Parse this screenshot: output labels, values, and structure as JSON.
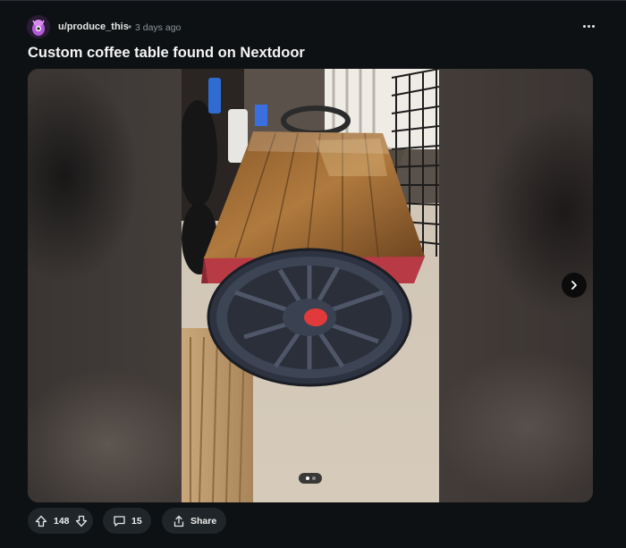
{
  "post": {
    "username": "u/produce_this",
    "separator": "•",
    "timestamp": "3 days ago",
    "title": "Custom coffee table found on Nextdoor",
    "more_icon": "more-options-icon"
  },
  "media": {
    "carousel_total": 2,
    "carousel_current": 1,
    "next_icon": "chevron-right-icon"
  },
  "actions": {
    "upvote_count": "148",
    "comment_count": "15",
    "share_label": "Share"
  },
  "colors": {
    "background": "#0e1113",
    "pill": "#1f2528",
    "wheel_center": "#e03a3a"
  }
}
